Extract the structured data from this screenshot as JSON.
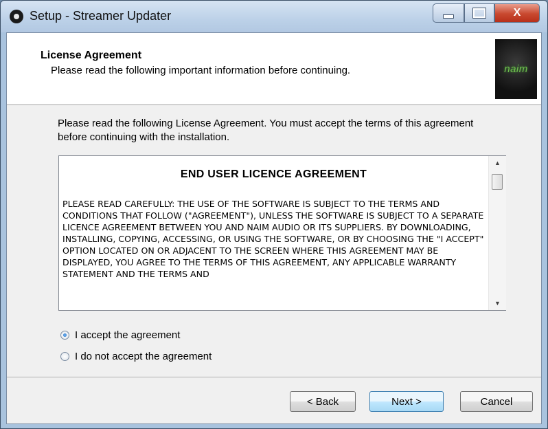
{
  "window": {
    "title": "Setup - Streamer Updater",
    "close_glyph": "X"
  },
  "header": {
    "title": "License Agreement",
    "subtitle": "Please read the following important information before continuing.",
    "logo_text": "naim"
  },
  "content": {
    "intro": "Please read the following License Agreement. You must accept the terms of this agreement before continuing with the installation.",
    "license_heading": "END USER LICENCE AGREEMENT",
    "license_body": "PLEASE READ CAREFULLY: THE USE OF THE SOFTWARE IS SUBJECT TO THE TERMS AND CONDITIONS THAT FOLLOW (\"AGREEMENT\"), UNLESS THE SOFTWARE IS SUBJECT TO A SEPARATE LICENCE AGREEMENT BETWEEN YOU AND NAIM AUDIO OR ITS SUPPLIERS. BY DOWNLOADING, INSTALLING, COPYING, ACCESSING, OR USING THE SOFTWARE, OR BY CHOOSING THE \"I ACCEPT\" OPTION LOCATED ON OR ADJACENT TO THE SCREEN WHERE THIS AGREEMENT MAY BE DISPLAYED, YOU AGREE TO THE TERMS OF THIS AGREEMENT, ANY APPLICABLE WARRANTY STATEMENT AND THE TERMS AND",
    "options": [
      {
        "label": "I accept the agreement",
        "selected": true
      },
      {
        "label": "I do not accept the agreement",
        "selected": false
      }
    ]
  },
  "buttons": {
    "back": "< Back",
    "next": "Next >",
    "cancel": "Cancel"
  },
  "colors": {
    "accent": "#3c7fb1",
    "close_red": "#c8482f",
    "logo_green": "#6fbf4f"
  },
  "icons": {
    "app": "setup-app-icon",
    "scroll_up": "scroll-up-arrow-icon",
    "scroll_down": "scroll-down-arrow-icon"
  }
}
